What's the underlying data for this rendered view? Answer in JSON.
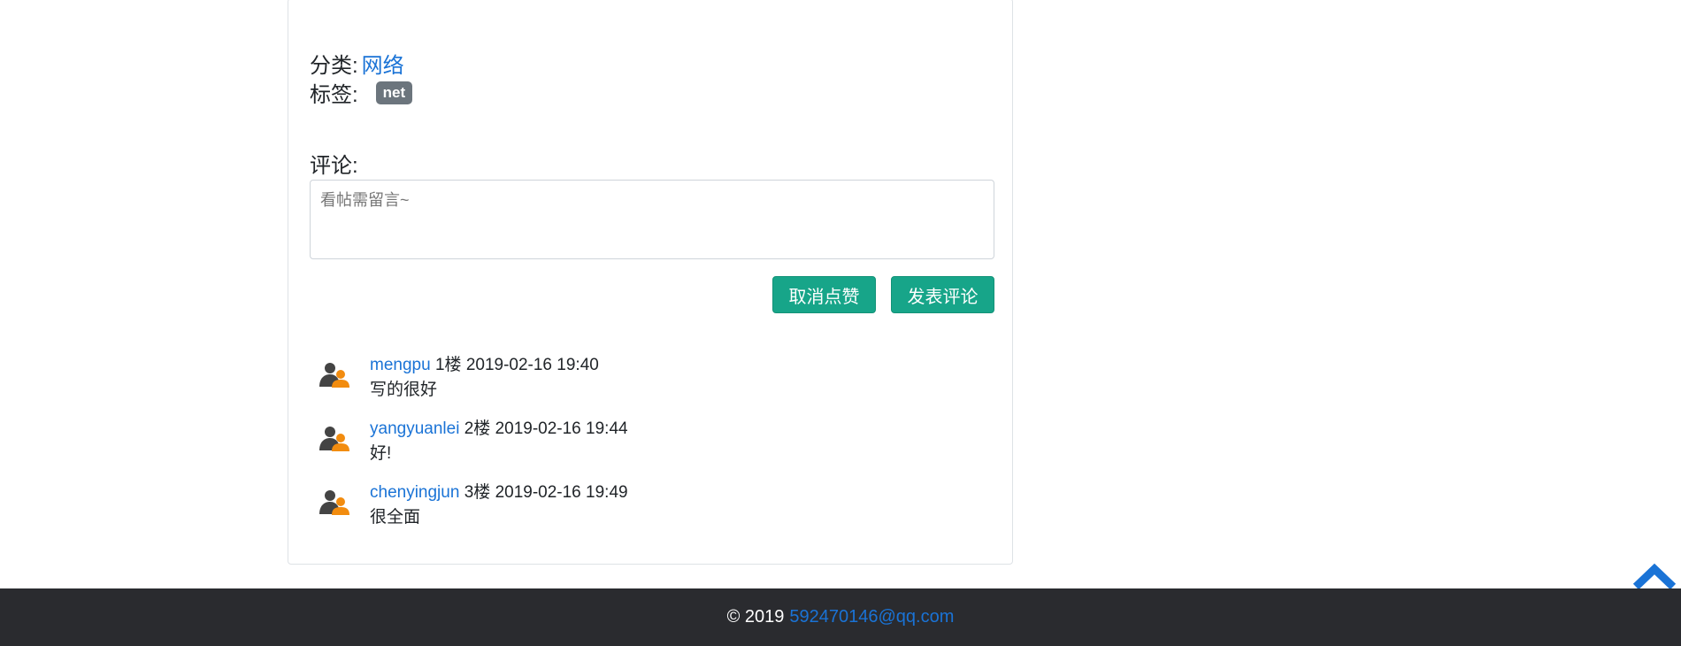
{
  "post": {
    "category_label": "分类:",
    "category_value": "网络",
    "tags_label": "标签:",
    "tags": [
      "net"
    ]
  },
  "comment_form": {
    "label": "评论:",
    "placeholder": "看帖需留言~",
    "unlike_label": "取消点赞",
    "submit_label": "发表评论"
  },
  "comments": [
    {
      "user": "mengpu",
      "floor": "1楼",
      "time": "2019-02-16 19:40",
      "text": "写的很好",
      "avatar_icon": "users-icon"
    },
    {
      "user": "yangyuanlei",
      "floor": "2楼",
      "time": "2019-02-16 19:44",
      "text": "好!",
      "avatar_icon": "users-icon"
    },
    {
      "user": "chenyingjun",
      "floor": "3楼",
      "time": "2019-02-16 19:49",
      "text": "很全面",
      "avatar_icon": "users-icon"
    }
  ],
  "footer": {
    "copyright": "© 2019",
    "email": "592470146@qq.com"
  },
  "back_to_top_icon": "chevron-up-icon",
  "colors": {
    "link": "#1a73d6",
    "button": "#17a589",
    "badge": "#6c757d",
    "footer_bg": "#2a2b2f",
    "back_to_top": "#1a73d6"
  }
}
